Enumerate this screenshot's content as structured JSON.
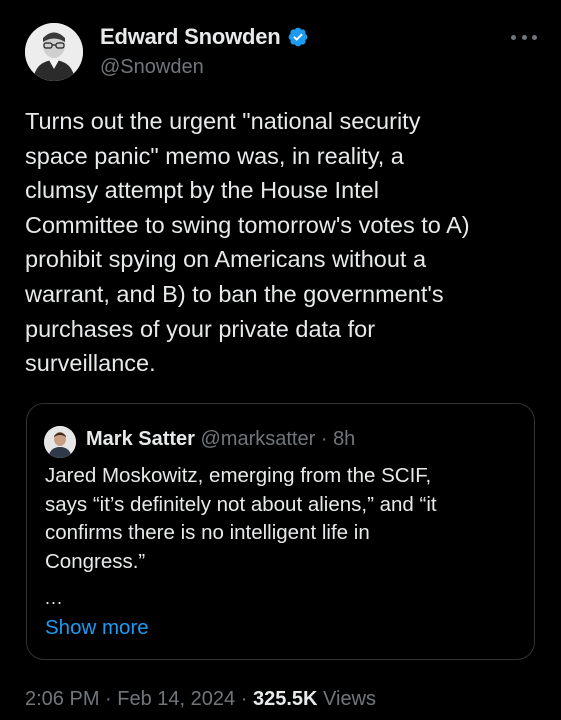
{
  "author": {
    "display_name": "Edward Snowden",
    "handle": "@Snowden",
    "verified_icon": "verified-badge-icon",
    "verified_color": "#1d9bf0"
  },
  "tweet": {
    "text_lines": [
      "Turns out the urgent \"national security",
      "space panic\" memo was, in reality, a",
      "clumsy attempt by the House Intel",
      "Committee to swing tomorrow's votes to A)",
      "prohibit spying on Americans without a",
      "warrant, and B) to ban the government's",
      "purchases of your private data for",
      "surveillance."
    ]
  },
  "quote": {
    "display_name": "Mark Satter",
    "handle": "@marksatter",
    "separator": "·",
    "time": "8h",
    "text_lines": [
      "Jared Moskowitz, emerging from the SCIF,",
      "says “it’s definitely not about aliens,” and “it",
      "confirms there is no intelligent life in",
      "Congress.”"
    ],
    "ellipsis": "...",
    "show_more": "Show more"
  },
  "meta": {
    "time": "2:06 PM",
    "sep1": "·",
    "date": "Feb 14, 2024",
    "sep2": "·",
    "views_count": "325.5K",
    "views_label": "Views"
  },
  "colors": {
    "background": "#000000",
    "text": "#e7e9ea",
    "muted": "#71767b",
    "link": "#1d9bf0",
    "border": "#2f3336"
  }
}
